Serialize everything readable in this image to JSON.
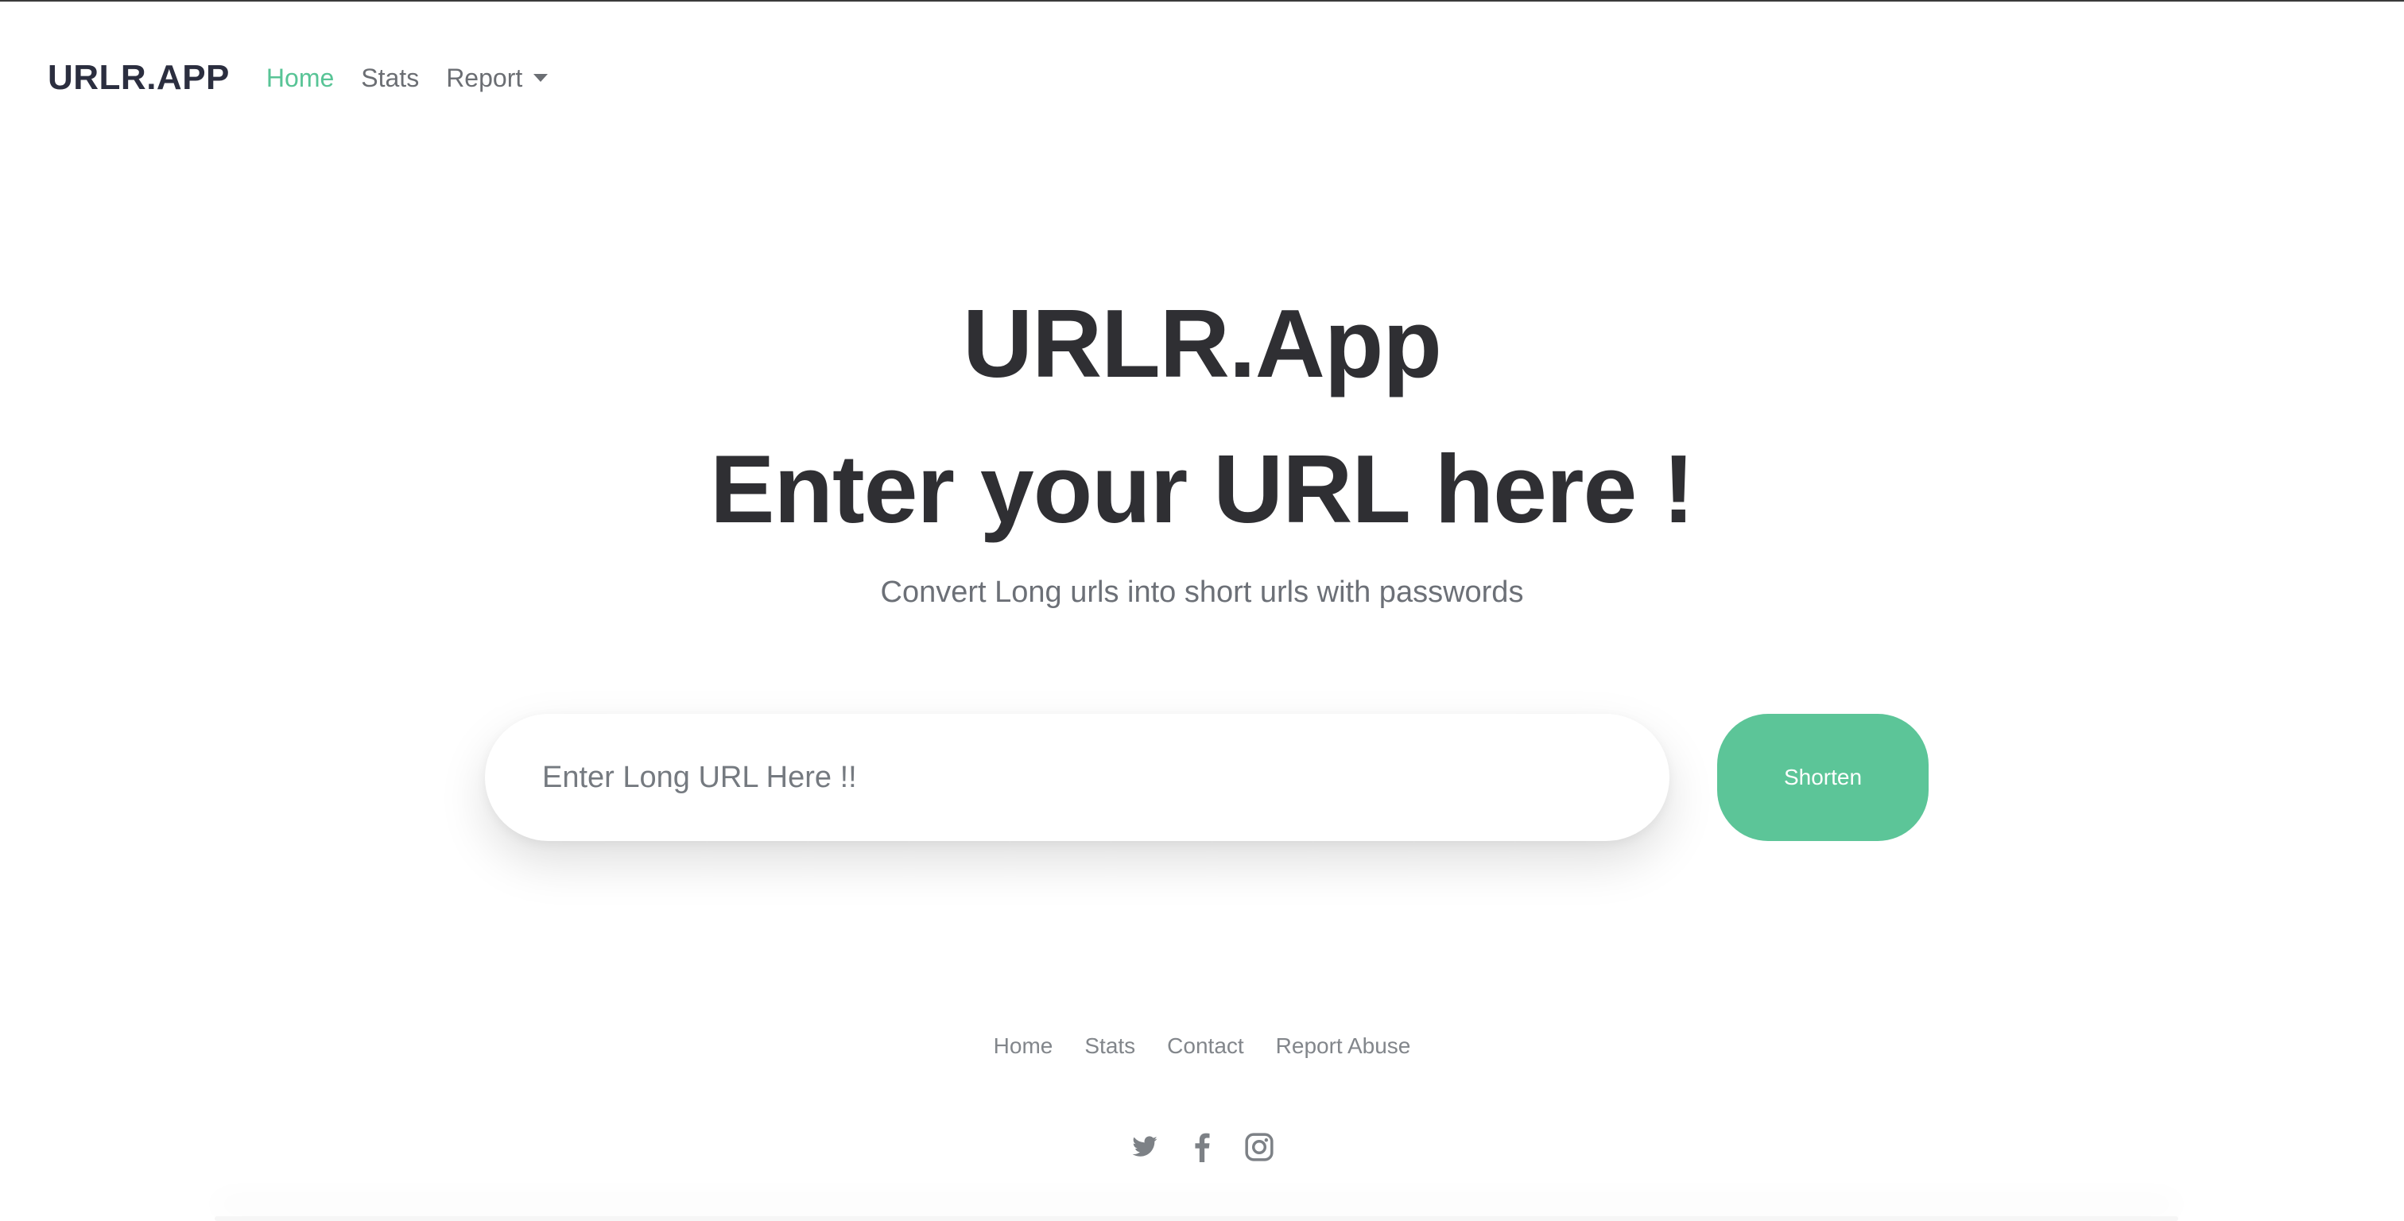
{
  "nav": {
    "brand": "URLR.APP",
    "items": [
      {
        "label": "Home"
      },
      {
        "label": "Stats"
      },
      {
        "label": "Report"
      }
    ]
  },
  "hero": {
    "title": "URLR.App",
    "heading": "Enter your URL here !",
    "subtitle": "Convert Long urls into short urls with passwords"
  },
  "form": {
    "placeholder": "Enter Long URL Here !!",
    "value": "",
    "button_label": "Shorten"
  },
  "footer": {
    "links": [
      {
        "label": "Home"
      },
      {
        "label": "Stats"
      },
      {
        "label": "Contact"
      },
      {
        "label": "Report Abuse"
      }
    ],
    "social_icons": [
      "twitter-icon",
      "facebook-icon",
      "instagram-icon"
    ]
  },
  "colors": {
    "accent": "#58c496",
    "button": "#5cc598",
    "text_dark": "#2f2f33",
    "text_muted": "#6c7077"
  }
}
